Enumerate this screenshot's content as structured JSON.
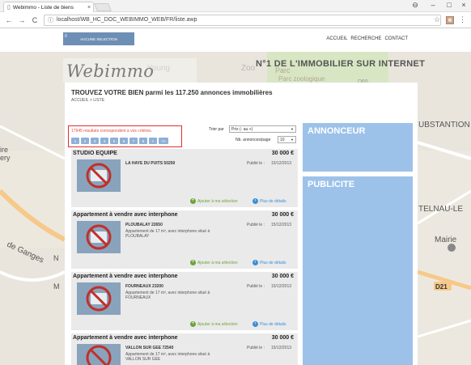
{
  "browser": {
    "tab_title": "Webimmo - Liste de biens",
    "tab_close": "×",
    "url": "localhost/WB_HC_DOC_WEBIMMO_WEB/FR/liste.awp",
    "win_profile": "⊖",
    "win_min": "–",
    "win_max": "□",
    "win_close": "×",
    "back": "←",
    "forward": "→",
    "reload": "C",
    "info": "ⓘ",
    "star": "☆",
    "ext_label": "▦",
    "menu": "⋮"
  },
  "header": {
    "selection_count": "0",
    "selection_label": "AUCUNE SELECTION",
    "nav": [
      "ACCUEIL",
      "RECHERCHE",
      "CONTACT"
    ],
    "logo": "Webimmo",
    "tagline": "N°1 DE L'IMMOBILIER SUR INTERNET"
  },
  "map": {
    "labels": [
      {
        "text": "Parc",
        "color": "#b0a890"
      },
      {
        "text": "Parc zoologique",
        "color": "#b0a890"
      },
      {
        "text": "Young",
        "color": "#b8b8b8"
      },
      {
        "text": "Zoo",
        "color": "#b8b8b8"
      },
      {
        "text": "D65",
        "color": "#999"
      },
      {
        "text": "UBSTANTION",
        "color": "#555"
      },
      {
        "text": "TELNAU-LE",
        "color": "#555"
      },
      {
        "text": "Mairie",
        "color": "#555"
      },
      {
        "text": "D21",
        "color": "#333"
      },
      {
        "text": "de Ganges",
        "color": "#555"
      },
      {
        "text": "ire",
        "color": "#555"
      },
      {
        "text": "ery",
        "color": "#555"
      },
      {
        "text": "N",
        "color": "#555"
      },
      {
        "text": "M",
        "color": "#555"
      }
    ]
  },
  "content": {
    "heading": "TROUVEZ VOTRE BIEN parmi les 117.250 annonces immobilières",
    "breadcrumb": [
      "ACCUEIL",
      "LISTE"
    ],
    "results_text": "17945 résultats correspondent à vos critères.",
    "pages": [
      "1",
      "2",
      "3",
      "4",
      "5",
      "6",
      "7",
      "8",
      ">",
      ">>"
    ],
    "sort_label": "Trier par",
    "sort_value": "Prix (- au +)",
    "perpage_label": "Nb. annonces/page",
    "perpage_value": "10",
    "select_arrow": "▼"
  },
  "listings": [
    {
      "title": "STUDIO EQUIPE",
      "price": "30 000 €",
      "city": "LA HAYE DU PUITS 50250",
      "desc": "",
      "published_label": "Publié le :",
      "date": "15/12/2013",
      "add_label": "Ajouter à ma sélection",
      "more_label": "Plus de détails"
    },
    {
      "title": "Appartement à vendre avec interphone",
      "price": "30 000 €",
      "city": "PLOUBALAY 22650",
      "desc": "Appartement de 17 m², avec interphone situé à PLOUBALAY",
      "published_label": "Publié le :",
      "date": "15/12/2013",
      "add_label": "Ajouter à ma sélection",
      "more_label": "Plus de détails"
    },
    {
      "title": "Appartement à vendre avec interphone",
      "price": "30 000 €",
      "city": "FOURNEAUX 23200",
      "desc": "Appartement de 17 m², avec interphone situé à FOURNEAUX",
      "published_label": "Publié le :",
      "date": "15/12/2013",
      "add_label": "Ajouter à ma sélection",
      "more_label": "Plus de détails"
    },
    {
      "title": "Appartement à vendre avec interphone",
      "price": "30 000 €",
      "city": "VALLON SUR GEE 72540",
      "desc": "Appartement de 17 m², avec interphone situé à VALLON SUR GEE",
      "published_label": "Publié le :",
      "date": "15/12/2013",
      "add_label": "",
      "more_label": ""
    }
  ],
  "sidebar": {
    "annonceur": "ANNONCEUR",
    "publicite": "PUBLICITE"
  },
  "colors": {
    "accent": "#9cc2ea",
    "pager": "#8fb0d6",
    "results": "#e74c3c",
    "highlight": "#e0302f"
  }
}
